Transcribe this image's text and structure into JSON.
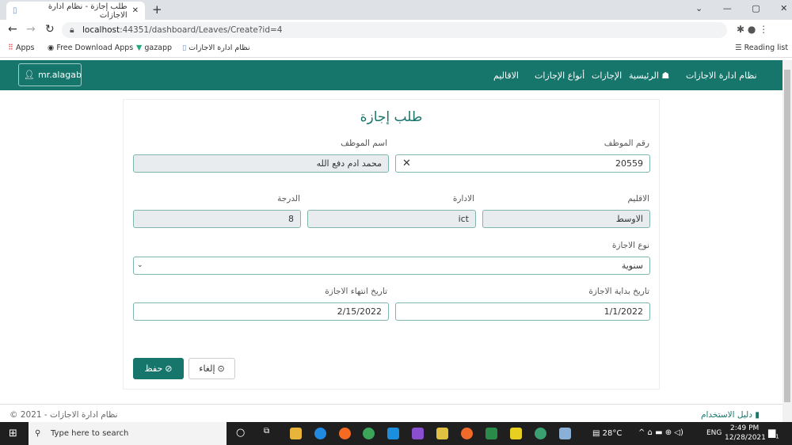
{
  "browser": {
    "tab_title": "طلب إجازة - نظام ادارة الاجازات",
    "url_host": "localhost",
    "url_rest": ":44351/dashboard/Leaves/Create?id=4",
    "bookmarks": [
      "Apps",
      "Free Download Apps",
      "gazapp",
      "نظام ادارة الاجازات"
    ],
    "reading_list": "Reading list"
  },
  "nav": {
    "brand": "نظام ادارة الاجازات",
    "links": [
      "الرئيسية",
      "الإجازات",
      "أنواع الإجازات",
      "الاقاليم"
    ],
    "user": "mr.alagab"
  },
  "form": {
    "title": "طلب إجازة",
    "employee_number": {
      "label": "رقم الموظف",
      "value": "20559",
      "clear": "✕"
    },
    "employee_name": {
      "label": "اسم الموظف",
      "value": "محمد ادم دفع الله"
    },
    "region": {
      "label": "الاقليم",
      "value": "الاوسط"
    },
    "department": {
      "label": "الادارة",
      "value": "ict"
    },
    "grade": {
      "label": "الدرجة",
      "value": "8"
    },
    "leave_type": {
      "label": "نوع الاجازة",
      "value": "سنوية"
    },
    "start_date": {
      "label": "تاريخ بداية الاجازة",
      "value": "1/1/2022"
    },
    "end_date": {
      "label": "تاريخ انتهاء الاجازة",
      "value": "2/15/2022"
    },
    "save": "حفظ",
    "cancel": "إلغاء"
  },
  "footer": {
    "copyright": "© 2021 - نظام ادارة الاجازات",
    "guide": "دليل الاستخدام"
  },
  "taskbar": {
    "search_placeholder": "Type here to search",
    "weather": "28°C",
    "lang": "ENG",
    "time": "2:49 PM",
    "date": "12/28/2021",
    "notifications": "1"
  },
  "colors": {
    "primary": "#17766c"
  }
}
